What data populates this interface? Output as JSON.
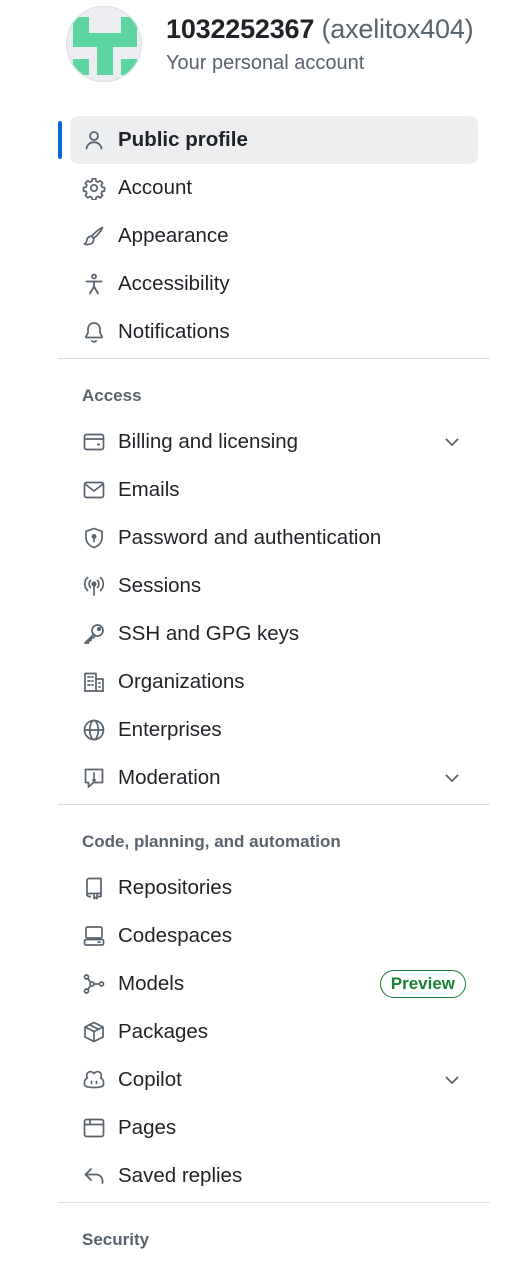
{
  "account": {
    "display_name": "1032252367",
    "login": "(axelitox404)",
    "subtitle": "Your personal account",
    "avatar_icon": "identicon-avatar",
    "avatar_color": "#5cd6a0"
  },
  "nav": {
    "primary": [
      {
        "label": "Public profile",
        "icon": "person-icon",
        "active": true
      },
      {
        "label": "Account",
        "icon": "gear-icon"
      },
      {
        "label": "Appearance",
        "icon": "paintbrush-icon"
      },
      {
        "label": "Accessibility",
        "icon": "accessibility-icon"
      },
      {
        "label": "Notifications",
        "icon": "bell-icon"
      }
    ],
    "access": {
      "heading": "Access",
      "items": [
        {
          "label": "Billing and licensing",
          "icon": "credit-card-icon",
          "expandable": true
        },
        {
          "label": "Emails",
          "icon": "mail-icon"
        },
        {
          "label": "Password and authentication",
          "icon": "shield-lock-icon"
        },
        {
          "label": "Sessions",
          "icon": "broadcast-icon"
        },
        {
          "label": "SSH and GPG keys",
          "icon": "key-icon"
        },
        {
          "label": "Organizations",
          "icon": "organization-icon"
        },
        {
          "label": "Enterprises",
          "icon": "globe-icon"
        },
        {
          "label": "Moderation",
          "icon": "report-icon",
          "expandable": true
        }
      ]
    },
    "code": {
      "heading": "Code, planning, and automation",
      "items": [
        {
          "label": "Repositories",
          "icon": "repo-icon"
        },
        {
          "label": "Codespaces",
          "icon": "codespaces-icon"
        },
        {
          "label": "Models",
          "icon": "models-icon",
          "badge": "Preview"
        },
        {
          "label": "Packages",
          "icon": "package-icon"
        },
        {
          "label": "Copilot",
          "icon": "copilot-icon",
          "expandable": true
        },
        {
          "label": "Pages",
          "icon": "browser-icon"
        },
        {
          "label": "Saved replies",
          "icon": "reply-icon"
        }
      ]
    },
    "security": {
      "heading": "Security"
    }
  },
  "colors": {
    "accent": "#0969da",
    "active_bg": "#eceef0",
    "badge_green": "#1a7f37",
    "muted_text": "#59636e"
  }
}
